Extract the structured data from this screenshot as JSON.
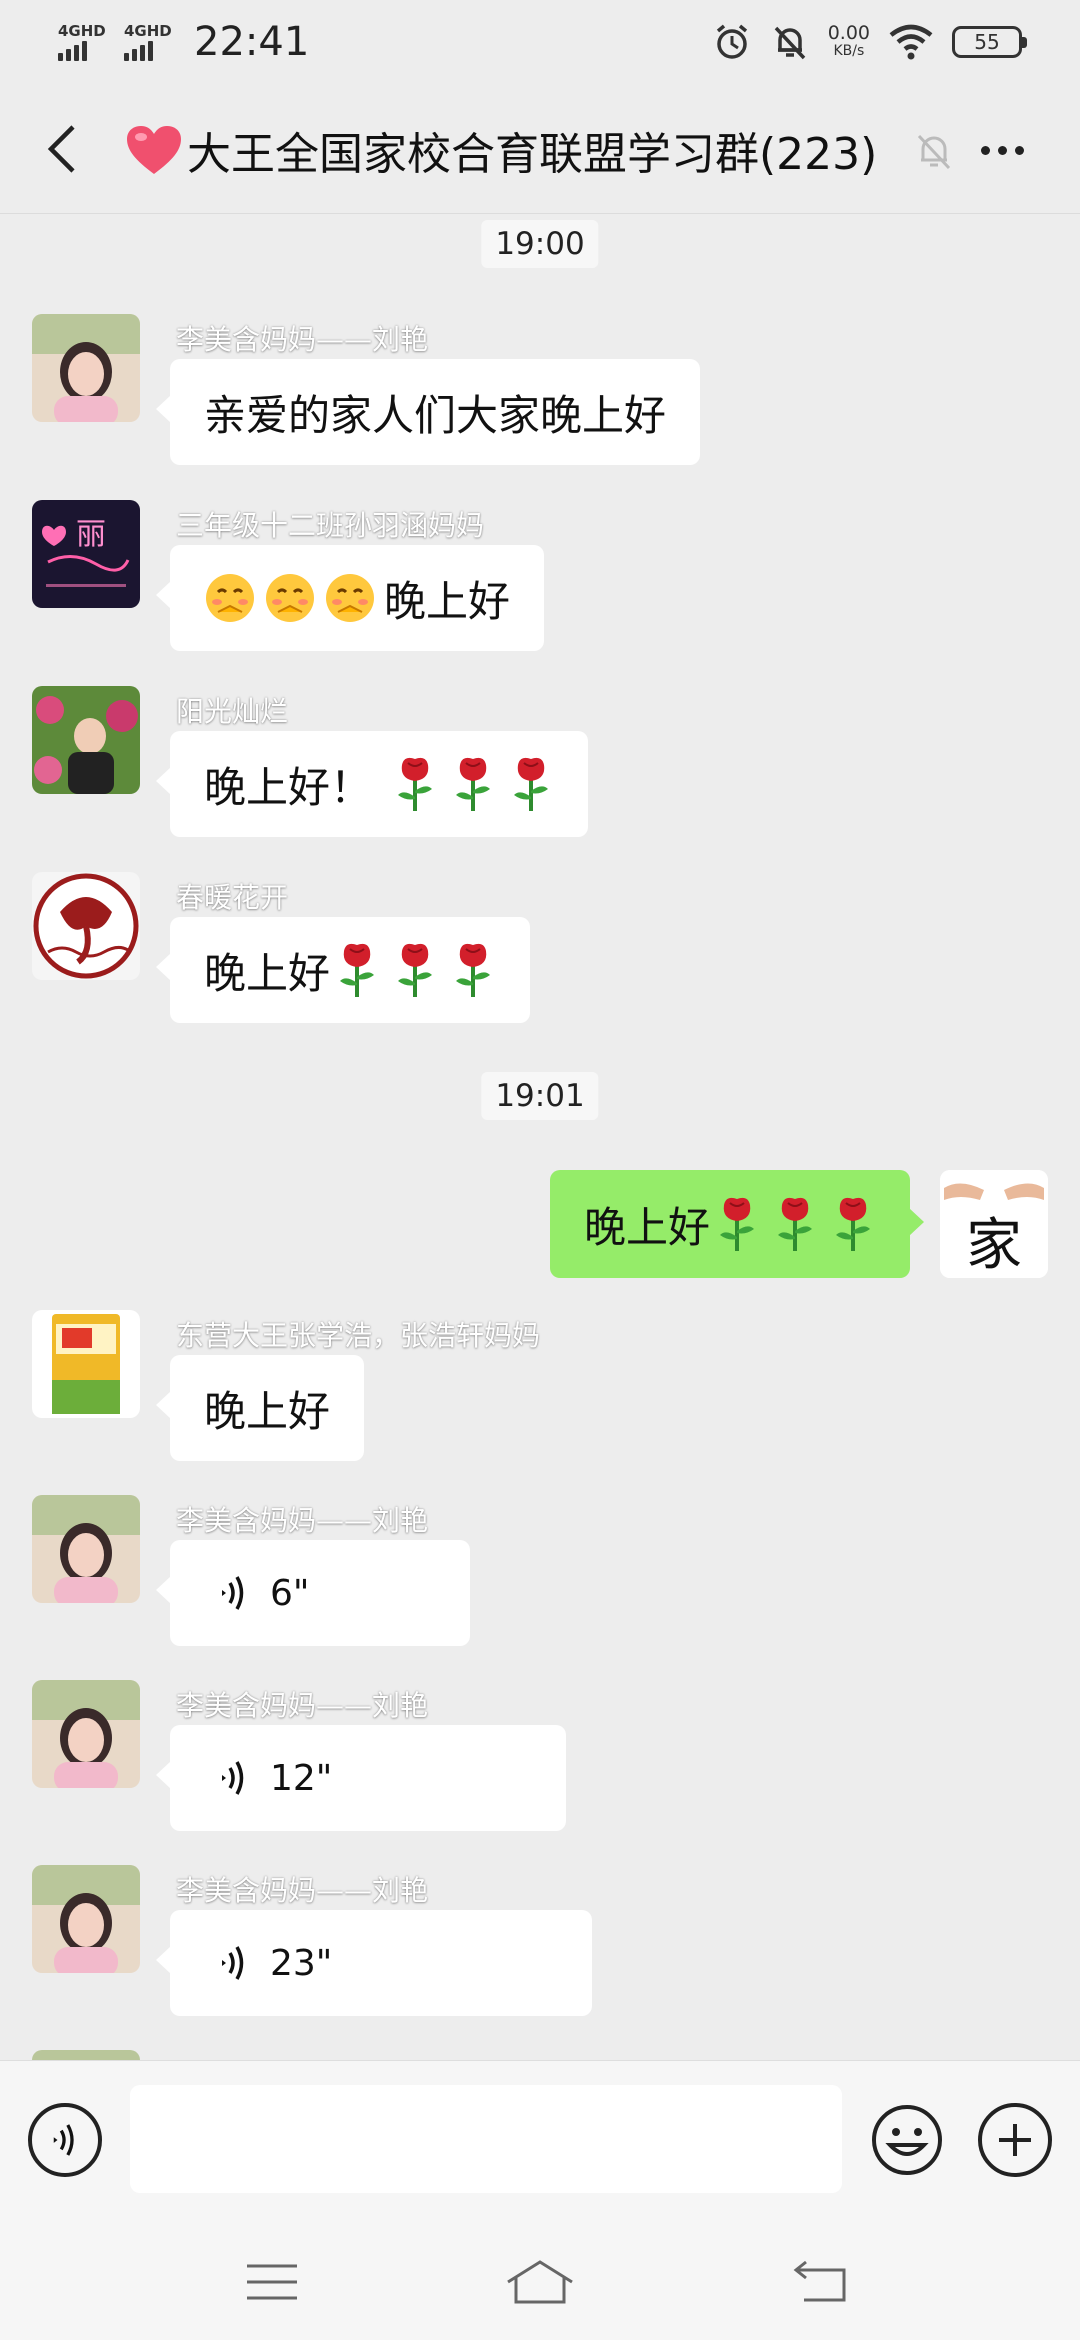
{
  "status_bar": {
    "network_1": "4GHD",
    "network_2": "4GHD",
    "time": "22:41",
    "speed_value": "0.00",
    "speed_unit": "KB/s",
    "battery": "55"
  },
  "nav": {
    "title": "大王全国家校合育联盟学习群(223)",
    "back_icon": "chevron-left-icon",
    "mute_icon": "bell-off-icon",
    "more_icon": "more-horizontal-icon"
  },
  "colors": {
    "background": "#ededed",
    "own_bubble": "#95ec69",
    "other_bubble": "#ffffff",
    "heart": "#f0506e"
  },
  "chat": {
    "timestamp_1": "19:00",
    "timestamp_2": "19:01",
    "messages": [
      {
        "sender": "李美含妈妈——刘艳",
        "text": "亲爱的家人们大家晚上好",
        "type": "text"
      },
      {
        "sender": "三年级十二班孙羽涵妈妈",
        "text": "晚上好",
        "type": "text",
        "emoji_icon": "blushing-face-icon"
      },
      {
        "sender": "阳光灿烂",
        "text": "晚上好！",
        "type": "text",
        "emoji_icon": "rose-icon"
      },
      {
        "sender": "春暖花开",
        "text": "晚上好",
        "type": "text",
        "emoji_icon": "rose-icon"
      },
      {
        "sender": "",
        "text": "晚上好",
        "type": "own",
        "emoji_icon": "rose-icon"
      },
      {
        "sender": "东营大王张学浩，张浩轩妈妈",
        "text": "晚上好",
        "type": "text"
      },
      {
        "sender": "李美含妈妈——刘艳",
        "text": "6\"",
        "type": "voice"
      },
      {
        "sender": "李美含妈妈——刘艳",
        "text": "12\"",
        "type": "voice"
      },
      {
        "sender": "李美含妈妈——刘艳",
        "text": "23\"",
        "type": "voice"
      }
    ],
    "avatars": {
      "avatar_2_text": "丽",
      "own_avatar_text": "家"
    }
  },
  "input_bar": {
    "voice_icon": "voice-icon",
    "placeholder": "",
    "emoji_icon": "smiley-icon",
    "plus_icon": "plus-circle-icon"
  },
  "system_nav": {
    "menu_icon": "menu-icon",
    "home_icon": "home-icon",
    "back_icon": "back-icon"
  }
}
